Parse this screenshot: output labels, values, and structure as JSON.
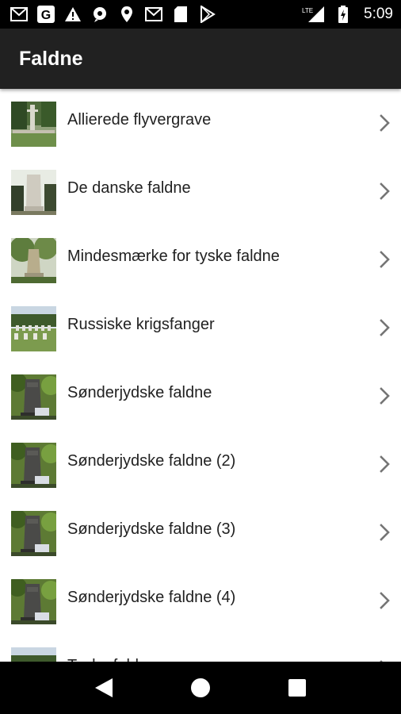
{
  "status_bar": {
    "time": "5:09",
    "left_icons": [
      "gmail-icon",
      "google-icon",
      "warning-icon",
      "maps-icon",
      "location-icon",
      "gmail-icon",
      "sd-card-icon",
      "play-store-icon"
    ],
    "network_label": "LTE"
  },
  "app_bar": {
    "title": "Faldne",
    "background": "#212121"
  },
  "list": {
    "items": [
      {
        "label": "Allierede flyvergrave",
        "thumb": "cemetery-park"
      },
      {
        "label": "De danske faldne",
        "thumb": "stone-monument"
      },
      {
        "label": "Mindesmærke for tyske faldne",
        "thumb": "memorial-tree"
      },
      {
        "label": "Russiske krigsfanger",
        "thumb": "grave-rows"
      },
      {
        "label": "Sønderjydske faldne",
        "thumb": "dark-stone"
      },
      {
        "label": "Sønderjydske faldne (2)",
        "thumb": "dark-stone"
      },
      {
        "label": "Sønderjydske faldne (3)",
        "thumb": "dark-stone"
      },
      {
        "label": "Sønderjydske faldne (4)",
        "thumb": "dark-stone"
      },
      {
        "label": "Tyske faldne",
        "thumb": "grave-rows"
      }
    ]
  },
  "nav_bar": {
    "buttons": [
      "back-icon",
      "home-icon",
      "recents-icon"
    ]
  }
}
